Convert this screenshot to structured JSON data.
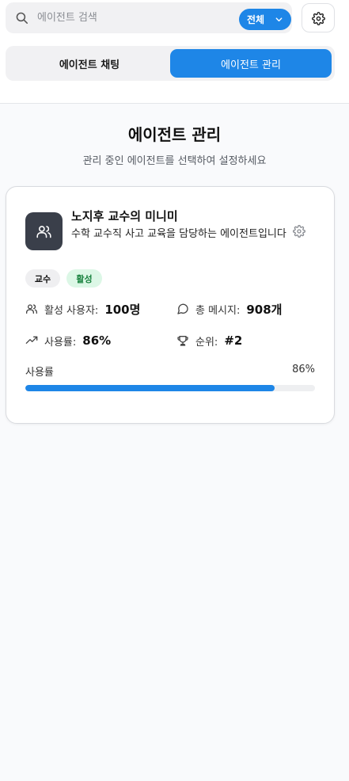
{
  "search": {
    "placeholder": "에이전트 검색",
    "filter_label": "전체"
  },
  "tabs": [
    {
      "label": "에이전트 채팅",
      "active": false
    },
    {
      "label": "에이전트 관리",
      "active": true
    }
  ],
  "page": {
    "title": "에이전트 관리",
    "subtitle": "관리 중인 에이전트를 선택하여 설정하세요"
  },
  "agent": {
    "icon": "users-icon",
    "name": "노지후 교수의 미니미",
    "description": "수학 교수직 사고 교육을 담당하는 에이전트입니다",
    "badges": {
      "role": "교수",
      "status": "활성"
    },
    "stats": {
      "users_label": "활성 사용자:",
      "users_value": "100명",
      "messages_label": "총 메시지:",
      "messages_value": "908개",
      "usage_label": "사용률:",
      "usage_value": "86%",
      "rank_label": "순위:",
      "rank_value": "#2"
    },
    "progress": {
      "label": "사용률",
      "percent_text": "86%",
      "value": 86
    }
  },
  "colors": {
    "accent": "#1e86e7",
    "avatar_bg": "#3a3f4a",
    "status_badge_bg": "#dcf7e6",
    "status_badge_text": "#16803c"
  }
}
